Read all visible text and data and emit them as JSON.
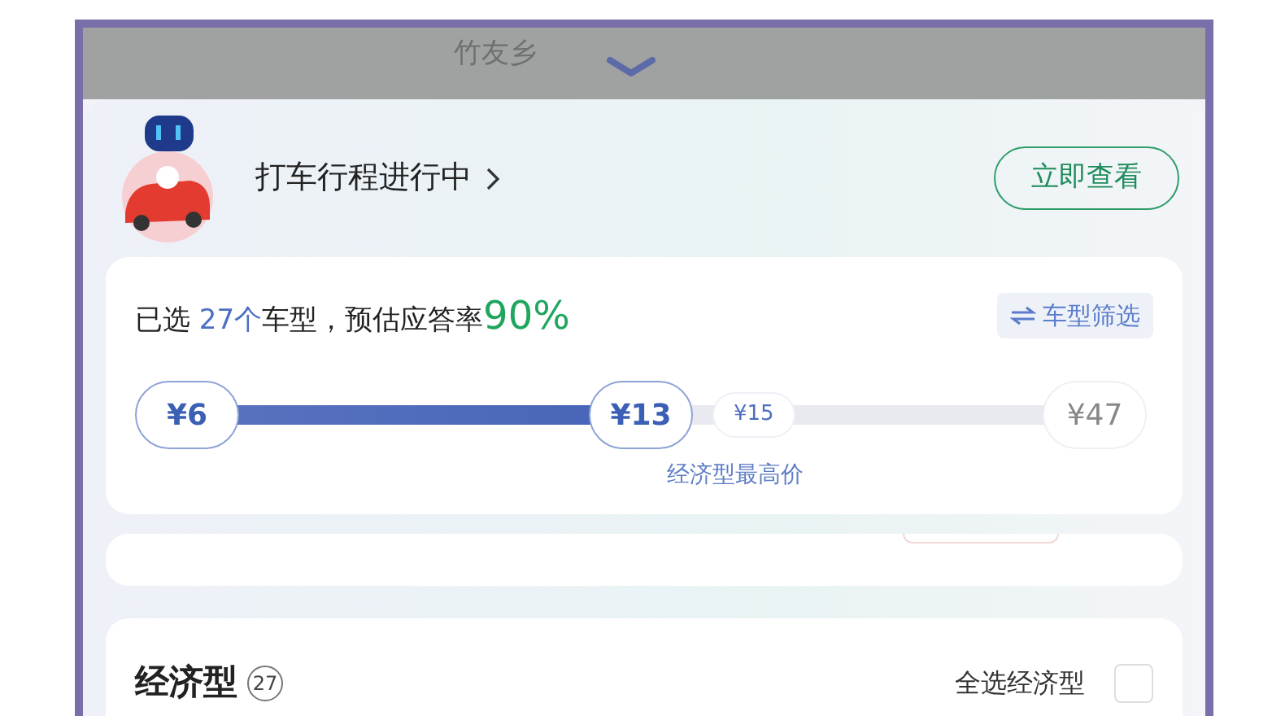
{
  "map": {
    "place_label": "竹友乡"
  },
  "trip_banner": {
    "title": "打车行程进行中",
    "button": "立即查看"
  },
  "summary": {
    "selected_prefix": "已选",
    "selected_count": "27个",
    "selected_suffix": "车型，预估应答率",
    "answer_rate": "90%",
    "filter_button": "车型筛选"
  },
  "price_slider": {
    "min_label": "¥6",
    "selected_max_label": "¥13",
    "level": 0.5,
    "marker_label": "¥15",
    "marker_caption": "经济型最高价",
    "max_label": "¥47"
  },
  "category": {
    "title": "经济型",
    "count": "27",
    "select_all_label": "全选经济型",
    "checked": false
  }
}
